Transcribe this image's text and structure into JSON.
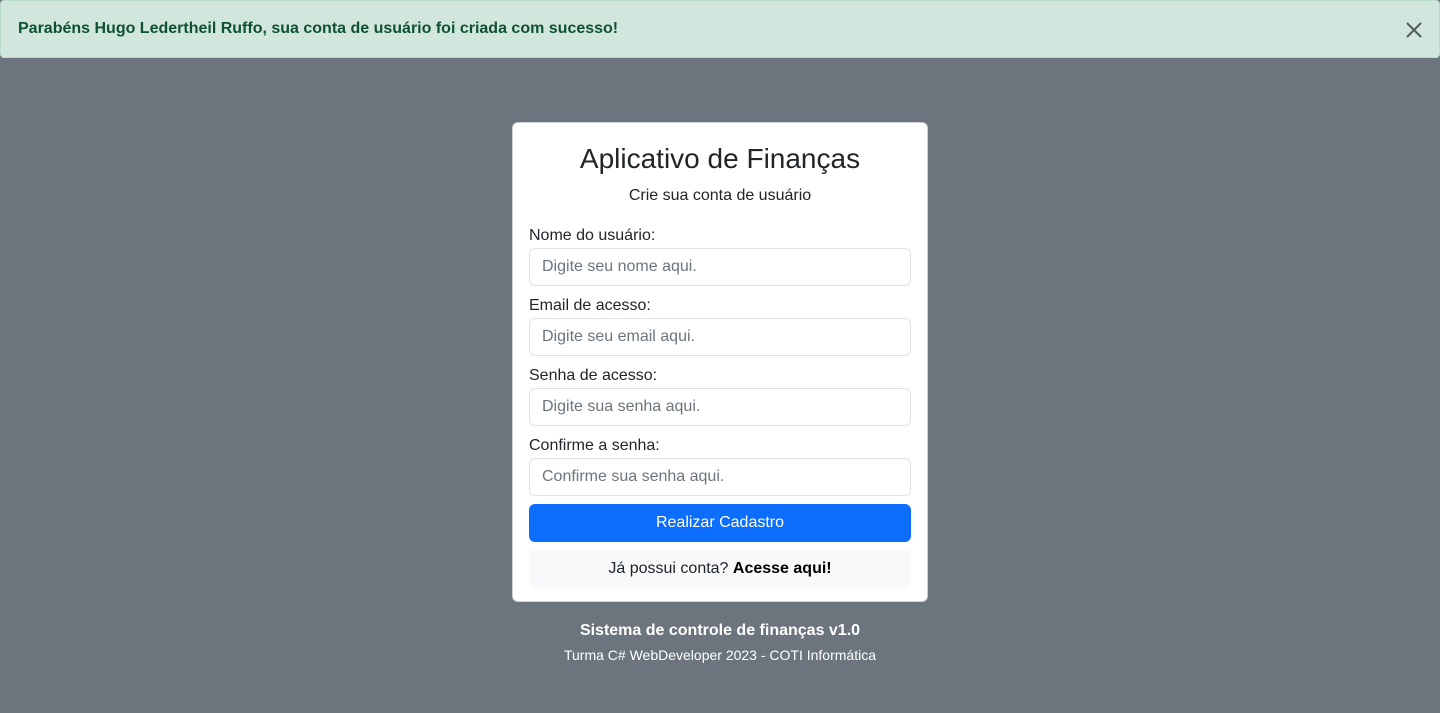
{
  "alert": {
    "message": "Parabéns Hugo Ledertheil Ruffo, sua conta de usuário foi criada com sucesso!",
    "close_icon": "close-icon"
  },
  "card": {
    "title": "Aplicativo de Finanças",
    "subtitle": "Crie sua conta de usuário",
    "fields": [
      {
        "label": "Nome do usuário:",
        "placeholder": "Digite seu nome aqui.",
        "value": ""
      },
      {
        "label": "Email de acesso:",
        "placeholder": "Digite seu email aqui.",
        "value": ""
      },
      {
        "label": "Senha de acesso:",
        "placeholder": "Digite sua senha aqui.",
        "value": ""
      },
      {
        "label": "Confirme a senha:",
        "placeholder": "Confirme sua senha aqui.",
        "value": ""
      }
    ],
    "submit_label": "Realizar Cadastro",
    "login_prompt": "Já possui conta?",
    "login_link": "Acesse aqui!"
  },
  "footer": {
    "title": "Sistema de controle de finanças v1.0",
    "subtitle": "Turma C# WebDeveloper 2023 - COTI Informática"
  },
  "colors": {
    "background": "#6c757d",
    "alert_bg": "#d1e7dd",
    "alert_text": "#0f5132",
    "primary": "#0d6efd"
  }
}
